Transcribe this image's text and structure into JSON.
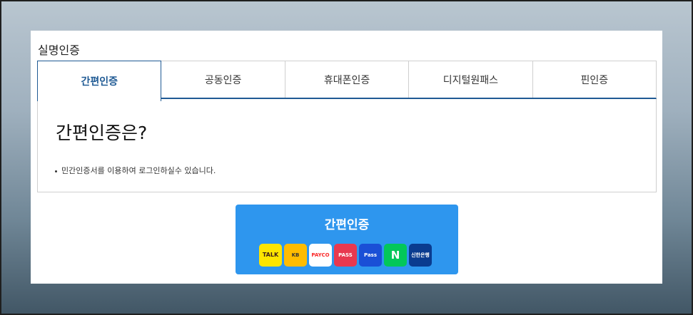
{
  "section": {
    "title": "실명인증"
  },
  "tabs": [
    {
      "label": "간편인증",
      "active": true
    },
    {
      "label": "공동인증",
      "active": false
    },
    {
      "label": "휴대폰인증",
      "active": false
    },
    {
      "label": "디지털원패스",
      "active": false
    },
    {
      "label": "핀인증",
      "active": false
    }
  ],
  "info": {
    "title": "간편인증은?",
    "bullet": "민간인증서를 이용하여 로그인하실수 있습니다."
  },
  "auth_button": {
    "label": "간편인증",
    "providers": [
      {
        "name": "kakao-icon",
        "text": "TALK"
      },
      {
        "name": "kb-icon",
        "text": "KB"
      },
      {
        "name": "payco-icon",
        "text": "PAYCO"
      },
      {
        "name": "pass-icon",
        "text": "PASS"
      },
      {
        "name": "samsung-pass-icon",
        "text": "Pass"
      },
      {
        "name": "naver-icon",
        "text": "N"
      },
      {
        "name": "shinhan-icon",
        "text": "신한은행"
      }
    ]
  },
  "colors": {
    "accent": "#1f5a94",
    "button": "#2e96ee"
  }
}
